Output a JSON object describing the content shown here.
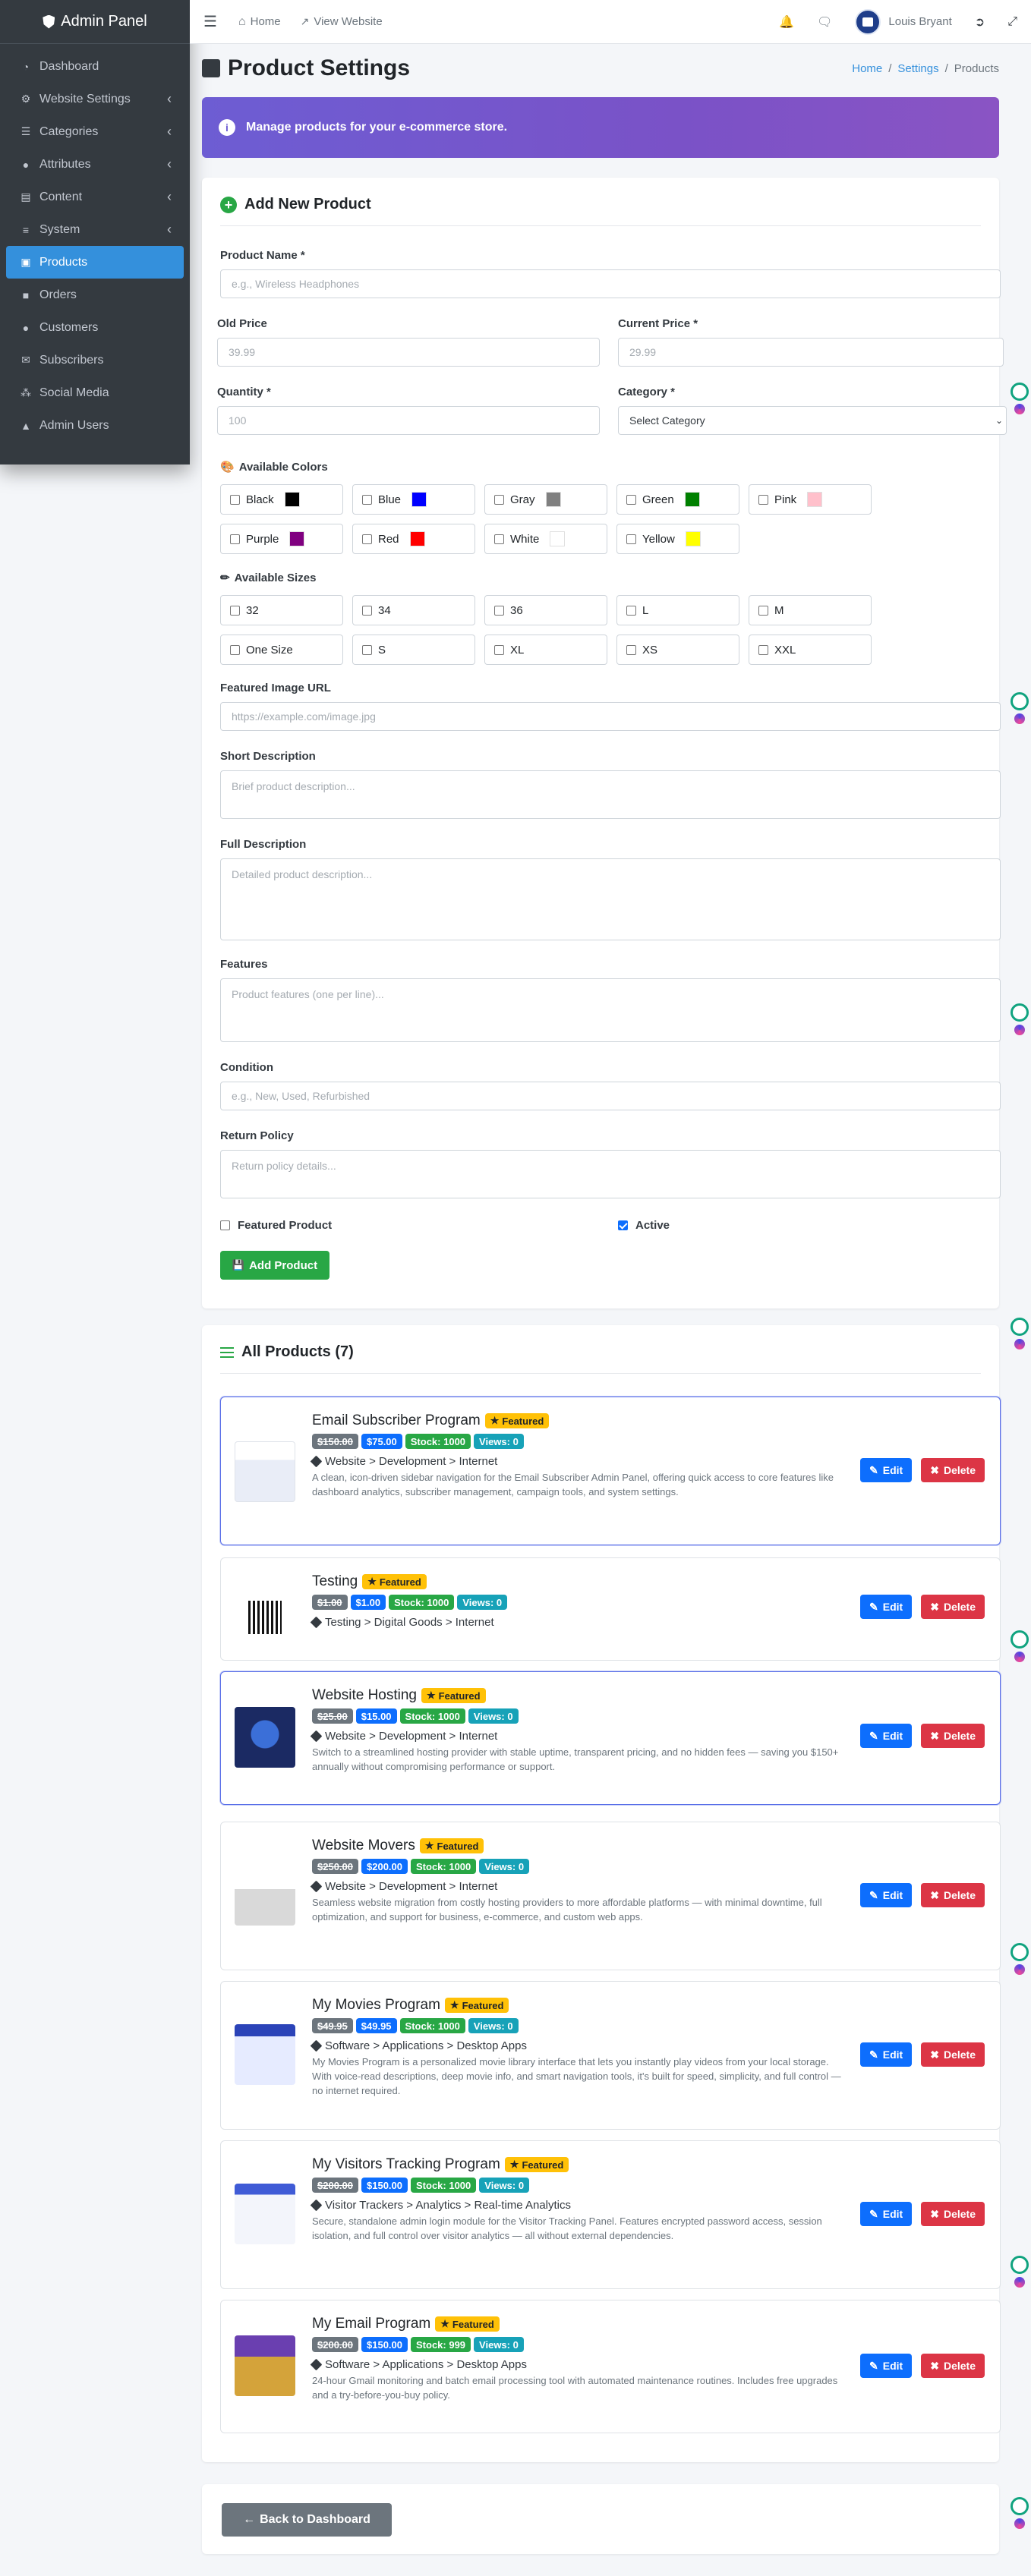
{
  "sidebar": {
    "brand": "Admin Panel",
    "items": [
      {
        "label": "Dashboard",
        "icon": "dashboard-icon",
        "chevron": false
      },
      {
        "label": "Website Settings",
        "icon": "gear-icon",
        "chevron": true
      },
      {
        "label": "Categories",
        "icon": "sitemap-icon",
        "chevron": true
      },
      {
        "label": "Attributes",
        "icon": "palette-icon",
        "chevron": true
      },
      {
        "label": "Content",
        "icon": "file-icon",
        "chevron": true
      },
      {
        "label": "System",
        "icon": "server-icon",
        "chevron": true
      },
      {
        "label": "Products",
        "icon": "box-icon",
        "chevron": false,
        "active": true
      },
      {
        "label": "Orders",
        "icon": "cart-icon",
        "chevron": false
      },
      {
        "label": "Customers",
        "icon": "users-icon",
        "chevron": false
      },
      {
        "label": "Subscribers",
        "icon": "envelope-icon",
        "chevron": false
      },
      {
        "label": "Social Media",
        "icon": "share-icon",
        "chevron": false
      },
      {
        "label": "Admin Users",
        "icon": "user-shield-icon",
        "chevron": false
      }
    ]
  },
  "topbar": {
    "home": "Home",
    "view_website": "View Website",
    "user_name": "Louis Bryant"
  },
  "page": {
    "title": "Product Settings",
    "breadcrumb": [
      "Home",
      "Settings",
      "Products"
    ],
    "banner": "Manage products for your e-commerce store."
  },
  "form": {
    "title": "Add New Product",
    "product_name_label": "Product Name *",
    "product_name_placeholder": "e.g., Wireless Headphones",
    "old_price_label": "Old Price",
    "old_price_placeholder": "39.99",
    "current_price_label": "Current Price *",
    "current_price_placeholder": "29.99",
    "quantity_label": "Quantity *",
    "quantity_placeholder": "100",
    "category_label": "Category *",
    "category_value": "Select Category",
    "colors_label": "Available Colors",
    "colors": [
      {
        "name": "Black",
        "hex": "#000000"
      },
      {
        "name": "Blue",
        "hex": "#0000ff"
      },
      {
        "name": "Gray",
        "hex": "#808080"
      },
      {
        "name": "Green",
        "hex": "#008000"
      },
      {
        "name": "Pink",
        "hex": "#ffc0cb"
      },
      {
        "name": "Purple",
        "hex": "#800080"
      },
      {
        "name": "Red",
        "hex": "#ff0000"
      },
      {
        "name": "White",
        "hex": "#ffffff"
      },
      {
        "name": "Yellow",
        "hex": "#ffff00"
      }
    ],
    "sizes_label": "Available Sizes",
    "sizes": [
      "32",
      "34",
      "36",
      "L",
      "M",
      "One Size",
      "S",
      "XL",
      "XS",
      "XXL"
    ],
    "image_label": "Featured Image URL",
    "image_placeholder": "https://example.com/image.jpg",
    "short_desc_label": "Short Description",
    "short_desc_placeholder": "Brief product description...",
    "full_desc_label": "Full Description",
    "full_desc_placeholder": "Detailed product description...",
    "features_label": "Features",
    "features_placeholder": "Product features (one per line)...",
    "condition_label": "Condition",
    "condition_placeholder": "e.g., New, Used, Refurbished",
    "return_label": "Return Policy",
    "return_placeholder": "Return policy details...",
    "featured_label": "Featured Product",
    "featured_checked": false,
    "active_label": "Active",
    "active_checked": true,
    "submit_label": "Add Product"
  },
  "products_section": {
    "title": "All Products (7)",
    "featured_badge": "Featured",
    "edit_label": "Edit",
    "delete_label": "Delete",
    "items": [
      {
        "name": "Email Subscriber Program",
        "old_price": "$150.00",
        "price": "$75.00",
        "stock": "Stock: 1000",
        "views": "Views: 0",
        "path": "Website > Development > Internet",
        "desc": "A clean, icon-driven sidebar navigation for the Email Subscriber Admin Panel, offering quick access to core features like dashboard analytics, subscriber management, campaign tools, and system settings."
      },
      {
        "name": "Testing",
        "old_price": "$1.00",
        "price": "$1.00",
        "stock": "Stock: 1000",
        "views": "Views: 0",
        "path": "Testing > Digital Goods > Internet",
        "desc": ""
      },
      {
        "name": "Website Hosting",
        "old_price": "$25.00",
        "price": "$15.00",
        "stock": "Stock: 1000",
        "views": "Views: 0",
        "path": "Website > Development > Internet",
        "desc": "Switch to a streamlined hosting provider with stable uptime, transparent pricing, and no hidden fees — saving you $150+ annually without compromising performance or support."
      },
      {
        "name": "Website Movers",
        "old_price": "$250.00",
        "price": "$200.00",
        "stock": "Stock: 1000",
        "views": "Views: 0",
        "path": "Website > Development > Internet",
        "desc": "Seamless website migration from costly hosting providers to more affordable platforms — with minimal downtime, full optimization, and support for business, e-commerce, and custom web apps."
      },
      {
        "name": "My Movies Program",
        "old_price": "$49.95",
        "price": "$49.95",
        "stock": "Stock: 1000",
        "views": "Views: 0",
        "path": "Software > Applications > Desktop Apps",
        "desc": "My Movies Program is a personalized movie library interface that lets you instantly play videos from your local storage. With voice-read descriptions, deep movie info, and smart navigation tools, it's built for speed, simplicity, and full control — no internet required."
      },
      {
        "name": "My Visitors Tracking Program",
        "old_price": "$200.00",
        "price": "$150.00",
        "stock": "Stock: 1000",
        "views": "Views: 0",
        "path": "Visitor Trackers > Analytics > Real-time Analytics",
        "desc": "Secure, standalone admin login module for the Visitor Tracking Panel. Features encrypted password access, session isolation, and full control over visitor analytics — all without external dependencies."
      },
      {
        "name": "My Email Program",
        "old_price": "$200.00",
        "price": "$150.00",
        "stock": "Stock: 999",
        "views": "Views: 0",
        "path": "Software > Applications > Desktop Apps",
        "desc": "24-hour Gmail monitoring and batch email processing tool with automated maintenance routines. Includes free upgrades and a try-before-you-buy policy."
      }
    ]
  },
  "footer": {
    "back_label": "Back to Dashboard"
  }
}
